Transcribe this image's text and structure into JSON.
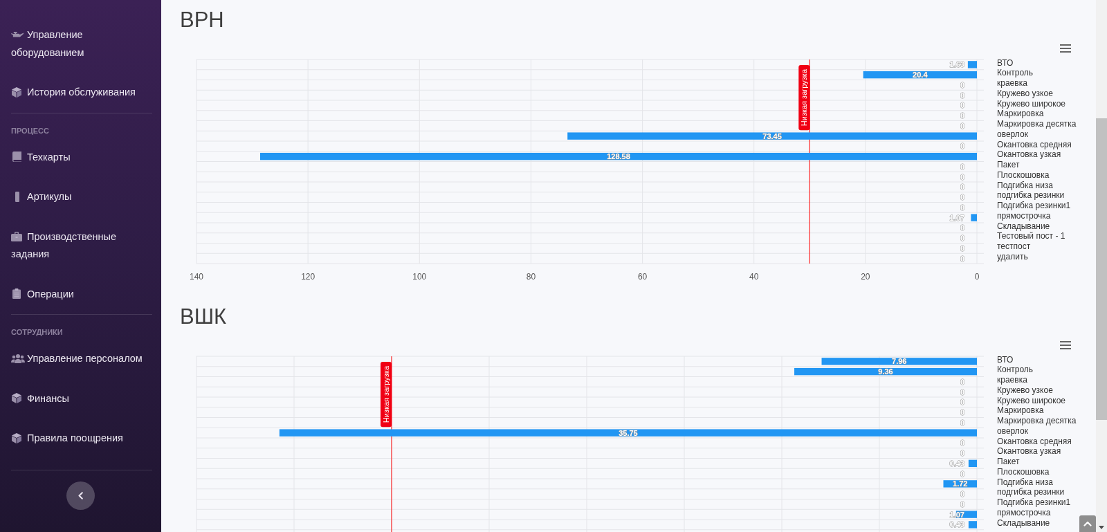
{
  "sidebar": {
    "sections": [
      {
        "items": [
          {
            "label": "Управление оборудованием",
            "selected": false
          },
          {
            "label": "История обслуживания",
            "selected": false
          }
        ]
      },
      {
        "title": "ПРОЦЕСС",
        "items": [
          {
            "label": "Техкарты",
            "selected": false
          },
          {
            "label": "Артикулы",
            "selected": false
          },
          {
            "label": "Производственные задания",
            "selected": false
          },
          {
            "label": "Операции",
            "selected": false
          }
        ]
      },
      {
        "title": "СОТРУДНИКИ",
        "items": [
          {
            "label": "Управление персоналом",
            "selected": false
          },
          {
            "label": "Финансы",
            "selected": false
          },
          {
            "label": "Правила поощрения",
            "selected": false
          }
        ]
      }
    ]
  },
  "charts": [
    {
      "title": "ВРН",
      "chart_data": {
        "type": "bar",
        "orientation": "horizontal",
        "categories": [
          "ВТО",
          "Контроль",
          "краевка",
          "Кружево узкое",
          "Кружево широкое",
          "Маркировка",
          "Маркировка десятка",
          "оверлок",
          "Окантовка средняя",
          "Окантовка узкая",
          "Пакет",
          "Плоскошовка",
          "Подгибка низа",
          "подгибка резинки",
          "Подгибка резинки1",
          "прямострочка",
          "Складывание",
          "Тестовый пост - 1",
          "тестпост",
          "удалить"
        ],
        "values": [
          1.63,
          20.4,
          0,
          0,
          0,
          0,
          0,
          73.45,
          0,
          128.58,
          0,
          0,
          0,
          0,
          0,
          1.07,
          0,
          0,
          0,
          0
        ],
        "xlim": [
          140,
          0
        ],
        "xticks": [
          140,
          120,
          100,
          80,
          60,
          40,
          20,
          0
        ],
        "grid": true,
        "data_labels": true,
        "ref_lines": [
          {
            "axis": "x",
            "value": 30,
            "label": "Низкая загрузка"
          }
        ]
      }
    },
    {
      "title": "ВШК",
      "chart_data": {
        "type": "bar",
        "orientation": "horizontal",
        "categories": [
          "ВТО",
          "Контроль",
          "краевка",
          "Кружево узкое",
          "Кружево широкое",
          "Маркировка",
          "Маркировка десятка",
          "оверлок",
          "Окантовка средняя",
          "Окантовка узкая",
          "Пакет",
          "Плоскошовка",
          "Подгибка низа",
          "подгибка резинки",
          "Подгибка резинки1",
          "прямострочка",
          "Складывание"
        ],
        "values": [
          7.96,
          9.36,
          0,
          0,
          0,
          0,
          0,
          35.75,
          0,
          0,
          0.43,
          0,
          1.72,
          0,
          0,
          1.07,
          0.43
        ],
        "xlim": [
          40,
          0
        ],
        "grid": true,
        "data_labels": true,
        "ref_lines": [
          {
            "axis": "x",
            "value": 30,
            "label": "Низкая загрузка"
          }
        ]
      }
    }
  ]
}
